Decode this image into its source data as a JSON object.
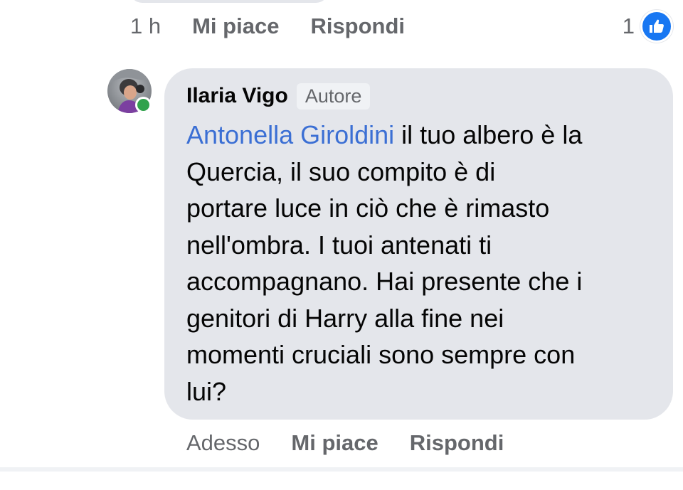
{
  "previous_comment": {
    "time": "1 h",
    "like_label": "Mi piace",
    "reply_label": "Rispondi",
    "reaction_count": "1",
    "reaction_icon": "thumbs-up-icon",
    "reaction_color": "#1877f2"
  },
  "comment": {
    "author": "Ilaria Vigo",
    "badge": "Autore",
    "mention": "Antonella Giroldini",
    "text_lines": [
      " il tuo albero è la",
      "Quercia, il suo compito è di",
      "portare luce in ciò che è rimasto",
      "nell'ombra. I tuoi antenati ti",
      "accompagnano. Hai presente che i",
      "genitori di Harry alla fine nei",
      "momenti cruciali sono sempre con",
      "lui?"
    ],
    "online": true,
    "online_color": "#31a24c",
    "time": "Adesso",
    "like_label": "Mi piace",
    "reply_label": "Rispondi"
  },
  "colors": {
    "bubble": "#e4e6eb",
    "mention": "#3b6fd4",
    "secondary_text": "#65676b"
  }
}
